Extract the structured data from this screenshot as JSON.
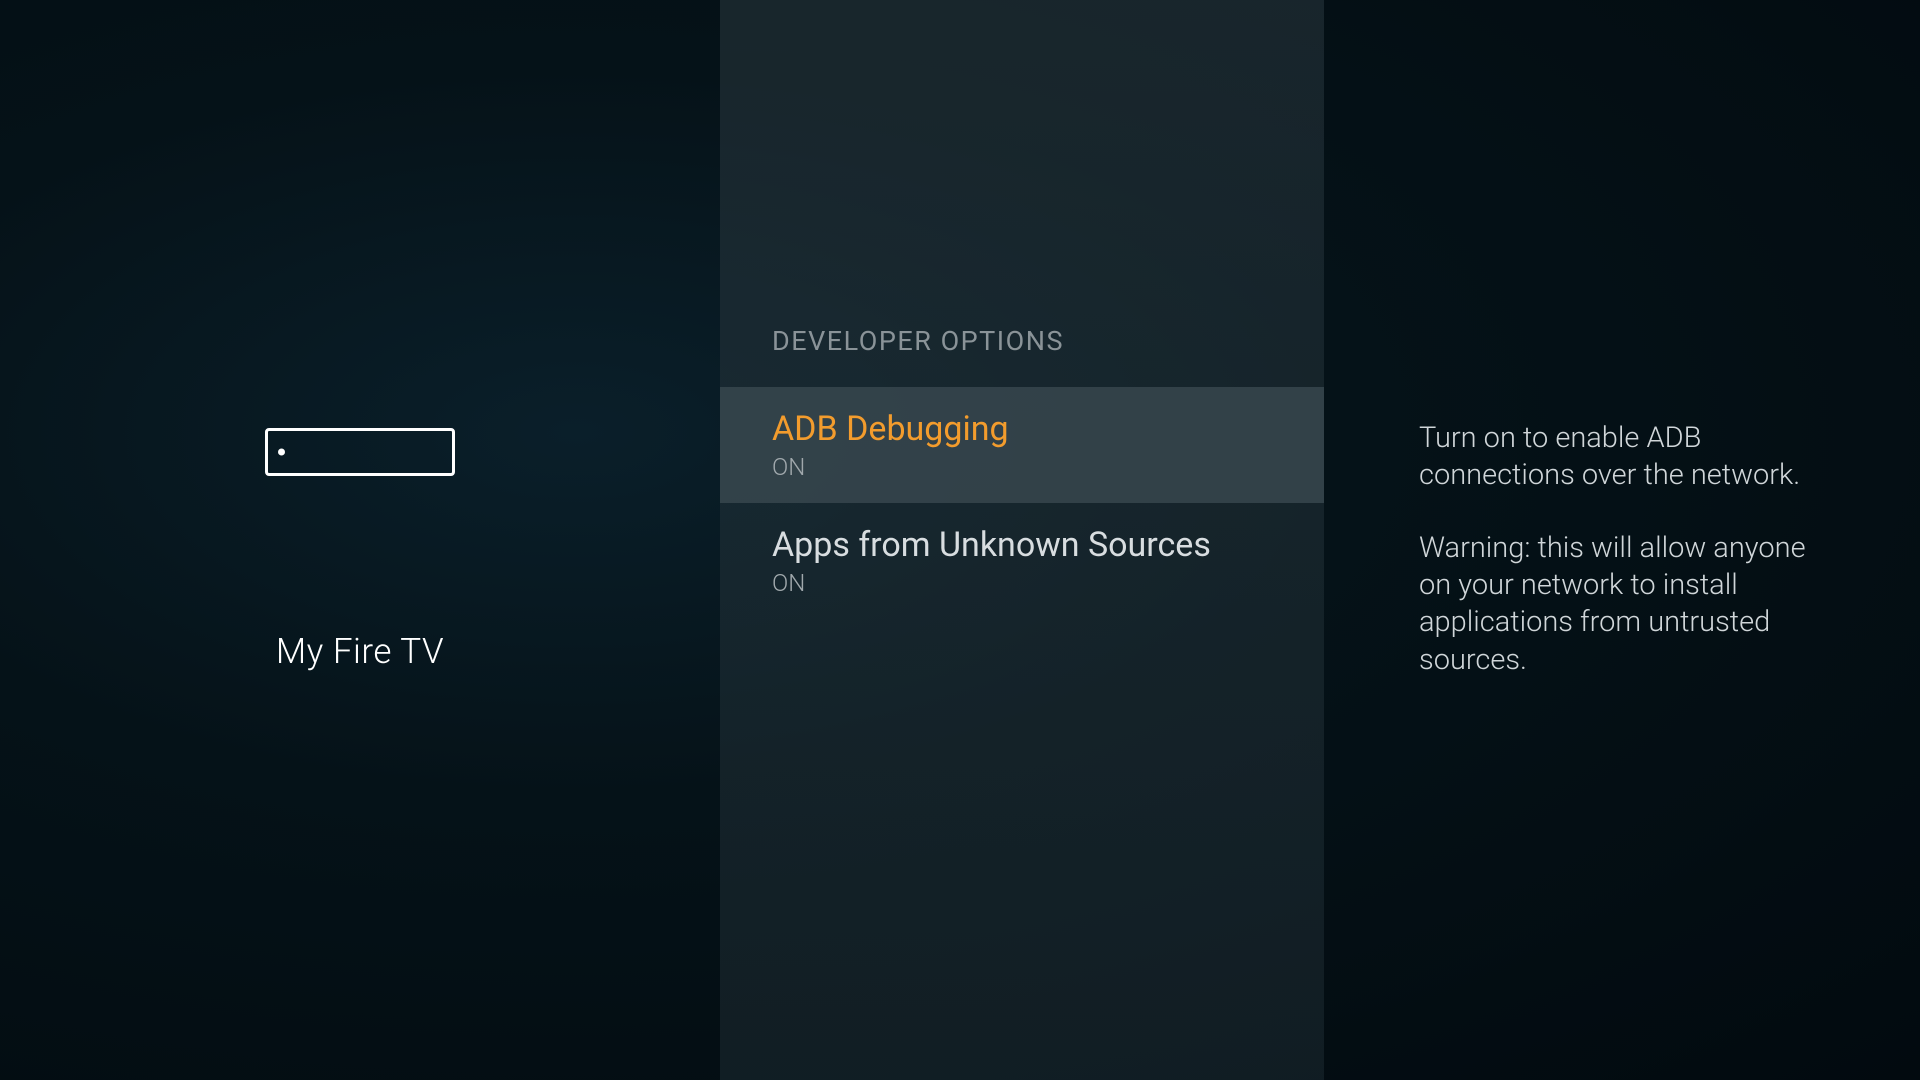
{
  "left": {
    "device_label": "My Fire TV"
  },
  "middle": {
    "section_header": "DEVELOPER OPTIONS",
    "options": [
      {
        "title": "ADB Debugging",
        "status": "ON",
        "selected": true
      },
      {
        "title": "Apps from Unknown Sources",
        "status": "ON",
        "selected": false
      }
    ]
  },
  "right": {
    "description_1": "Turn on to enable ADB connections over the network.",
    "description_2": "Warning: this will allow anyone on your network to install applications from untrusted sources."
  }
}
